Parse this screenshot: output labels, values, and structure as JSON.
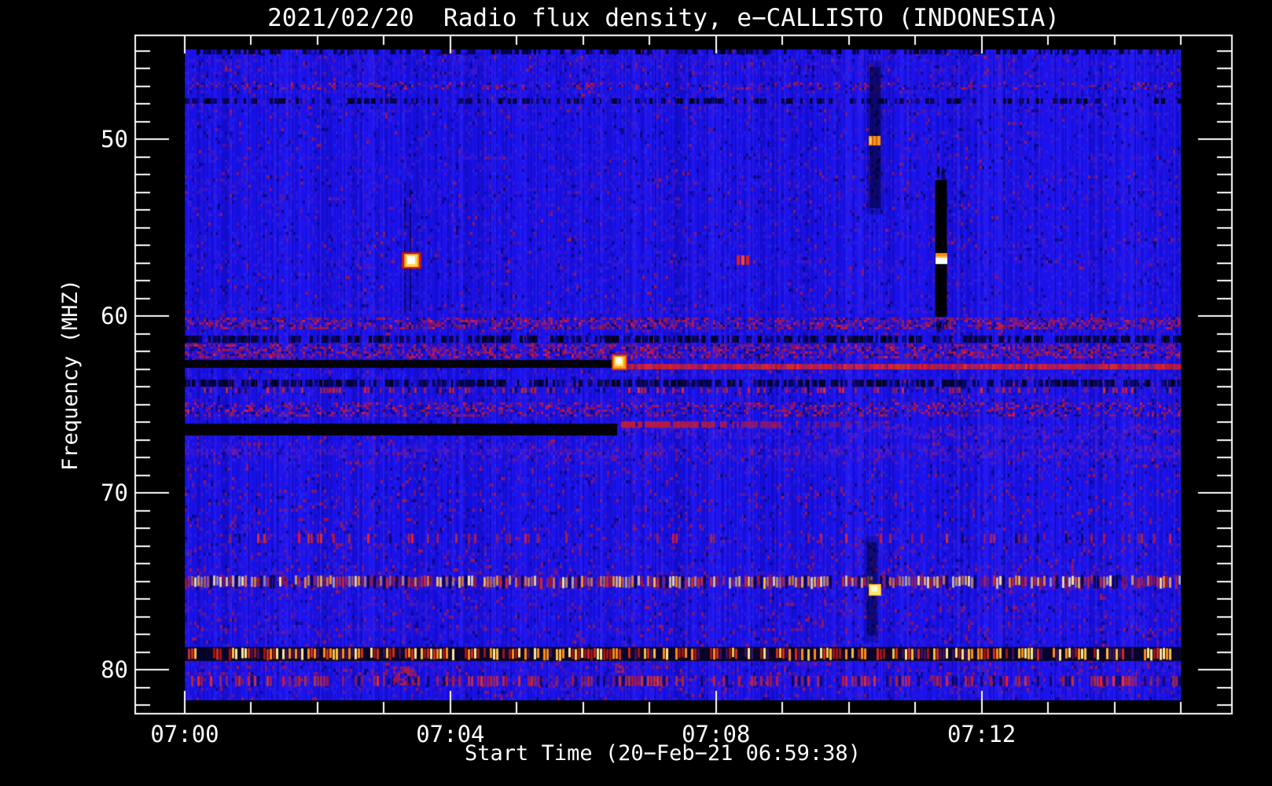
{
  "page": {
    "background": "#000000",
    "foreground": "#ffffff"
  },
  "chart_data": {
    "type": "heatmap",
    "subtype": "radio-spectrogram",
    "title": "2021/02/20  Radio flux density, e−CALLISTO (INDONESIA)",
    "xlabel": "Start Time (20−Feb−21 06:59:38)",
    "ylabel": "Frequency (MHZ)",
    "x_ticks": {
      "labels": [
        "07:00",
        "07:04",
        "07:08",
        "07:12"
      ],
      "minutes": [
        0,
        4,
        8,
        12
      ],
      "minor_every_min": 1,
      "total_minutes": 15
    },
    "y_ticks": {
      "labels": [
        "50",
        "60",
        "70",
        "80"
      ],
      "values": [
        50,
        60,
        70,
        80
      ],
      "minor_every_mhz": 1
    },
    "time_range": [
      "07:00",
      "07:15"
    ],
    "freq_range_mhz": [
      44.9,
      81.7
    ],
    "y_axis_inverted": true,
    "grid": false,
    "legend": false,
    "units": {
      "t": "minutes after 07:00",
      "f": "MHz"
    },
    "palette": {
      "background": "#1b12ec",
      "purple": "#6e1eb4",
      "red": "#c3202b",
      "orange": "#ff8c14",
      "yellow": "#ffd84a",
      "white": "#ffffff",
      "black": "#000000"
    },
    "bands": [
      {
        "f1": 44.9,
        "f2": 45.2,
        "style": "dark_dash",
        "strength": 0.5
      },
      {
        "f1": 46.8,
        "f2": 47.2,
        "style": "red_mottle",
        "strength": 0.3
      },
      {
        "f1": 47.7,
        "f2": 48.0,
        "style": "dark_dash",
        "strength": 0.45
      },
      {
        "f1": 60.1,
        "f2": 60.7,
        "style": "red_mottle",
        "strength": 0.75
      },
      {
        "f1": 61.1,
        "f2": 61.5,
        "style": "dark_dash",
        "strength": 0.7
      },
      {
        "f1": 61.6,
        "f2": 62.3,
        "style": "red_mottle",
        "strength": 0.8
      },
      {
        "f1": 62.5,
        "f2": 62.95,
        "t1": 0,
        "t2": 6.49,
        "style": "black_solid"
      },
      {
        "f1": 62.7,
        "f2": 63.0,
        "t1": 6.62,
        "t2": 15,
        "style": "red_line"
      },
      {
        "f1": 63.6,
        "f2": 64.0,
        "style": "dark_dash",
        "strength": 0.7
      },
      {
        "f1": 64.05,
        "f2": 64.35,
        "style": "red_dash",
        "strength": 0.5
      },
      {
        "f1": 64.9,
        "f2": 65.6,
        "style": "red_mottle",
        "strength": 0.55
      },
      {
        "f1": 66.1,
        "f2": 66.75,
        "t1": 0,
        "t2": 6.51,
        "style": "black_solid"
      },
      {
        "f1": 66.2,
        "f2": 66.8,
        "t1": 6.6,
        "t2": 15,
        "style": "purple_mottle",
        "strength": 0.5
      },
      {
        "f1": 65.95,
        "f2": 66.3,
        "t1": 6.57,
        "t2": 10.6,
        "style": "red_fade"
      },
      {
        "f1": 67.35,
        "f2": 68.05,
        "style": "purple_mottle",
        "strength": 0.55
      },
      {
        "f1": 72.3,
        "f2": 72.85,
        "style": "red_dash",
        "strength": 0.3
      },
      {
        "f1": 74.65,
        "f2": 75.4,
        "style": "orange_dash",
        "strength": 0.8
      },
      {
        "f1": 78.7,
        "f2": 79.5,
        "style": "strong_dash"
      },
      {
        "f1": 80.35,
        "f2": 80.95,
        "style": "red_dash",
        "strength": 0.8
      }
    ],
    "vertical_streaks": [
      {
        "t": 3.34,
        "f1": 52.4,
        "f2": 59.8,
        "type": "thin_double",
        "w": 7
      },
      {
        "t": 10.39,
        "f1": 45.9,
        "f2": 53.9,
        "type": "soft",
        "w": 14,
        "alpha": 0.5
      },
      {
        "t": 10.35,
        "f1": 72.8,
        "f2": 78.1,
        "type": "soft",
        "w": 12,
        "alpha": 0.45
      },
      {
        "t": 11.39,
        "f1": 52.3,
        "f2": 60.05,
        "type": "black_bar",
        "w": 15
      }
    ],
    "bursts": [
      {
        "t": 3.41,
        "f": 56.85,
        "type": "white_hot",
        "w": 17,
        "h": 15
      },
      {
        "t": 6.55,
        "f": 62.6,
        "type": "yellow_hot",
        "w": 16,
        "h": 16
      },
      {
        "t": 8.4,
        "f": 56.85,
        "type": "red_dashes",
        "w": 16,
        "h": 12
      },
      {
        "t": 10.39,
        "f": 50.1,
        "type": "orange",
        "w": 15,
        "h": 12
      },
      {
        "t": 11.39,
        "f": 56.75,
        "type": "bar_hotspot",
        "w": 15,
        "h": 14
      },
      {
        "t": 10.39,
        "f": 75.5,
        "type": "yellow",
        "w": 14,
        "h": 13
      },
      {
        "t": 6.53,
        "f": 79.85,
        "type": "red_patch",
        "w": 10,
        "h": 10
      },
      {
        "t": 3.3,
        "f": 80.3,
        "type": "red_patch",
        "w": 28,
        "h": 22
      }
    ]
  }
}
